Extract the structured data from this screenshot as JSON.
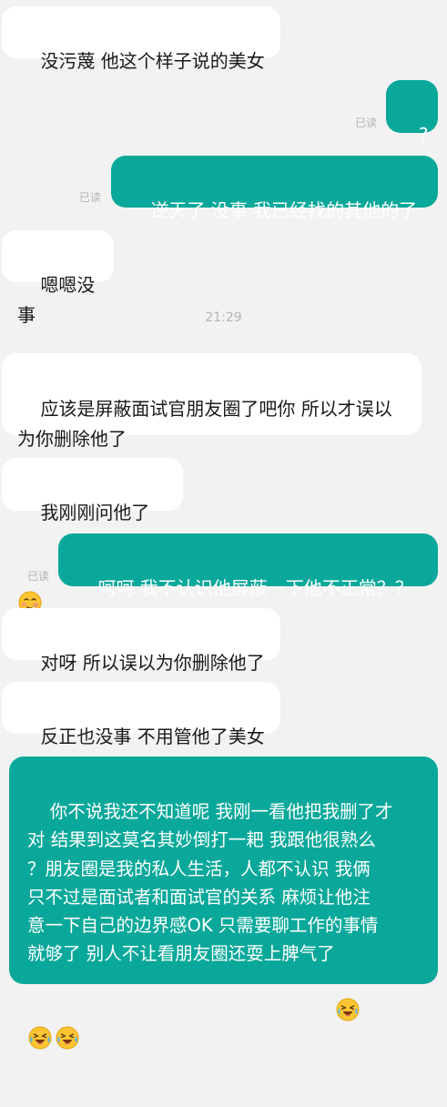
{
  "conversation": {
    "messages": [
      {
        "side": "in",
        "text": "没污蔑 他这个样子说的美女"
      },
      {
        "side": "out",
        "text": "?",
        "status": "已读"
      },
      {
        "side": "out",
        "text": "逆天了 没事 我已经找的其他的了",
        "status": "已读"
      },
      {
        "side": "in",
        "text": "嗯嗯没事"
      },
      {
        "time": "21:29"
      },
      {
        "side": "in",
        "text": "应该是屏蔽面试官朋友圈了吧你 所以才误以\n为你删除他了"
      },
      {
        "side": "in",
        "text": "我刚刚问他了",
        "emoji": "shy-smile-icon"
      },
      {
        "side": "out",
        "text": "呵呵 我不认识他屏蔽一下他不正常？？",
        "status": "已读"
      },
      {
        "side": "in",
        "text": "对呀 所以误以为你删除他了"
      },
      {
        "side": "in",
        "text": "反正也没事 不用管他了美女"
      },
      {
        "side": "out",
        "text": "你不说我还不知道呢 我刚一看他把我删了才\n对 结果到这莫名其妙倒打一耙 我跟他很熟么\n？朋友圈是我的私人生活，人都不认识 我俩\n只不过是面试者和面试官的关系 麻烦让他注\n意一下自己的边界感OK 只需要聊工作的事情\n就够了 别人不让看朋友圈还耍上脾气了",
        "emojis": [
          "crying-laughing-icon",
          "crying-laughing-icon",
          "crying-laughing-icon"
        ]
      }
    ]
  },
  "colors": {
    "background": "#f2f2f2",
    "incoming_bubble": "#ffffff",
    "outgoing_bubble": "#0aa89a",
    "read_receipt": "#b2b2b2"
  }
}
